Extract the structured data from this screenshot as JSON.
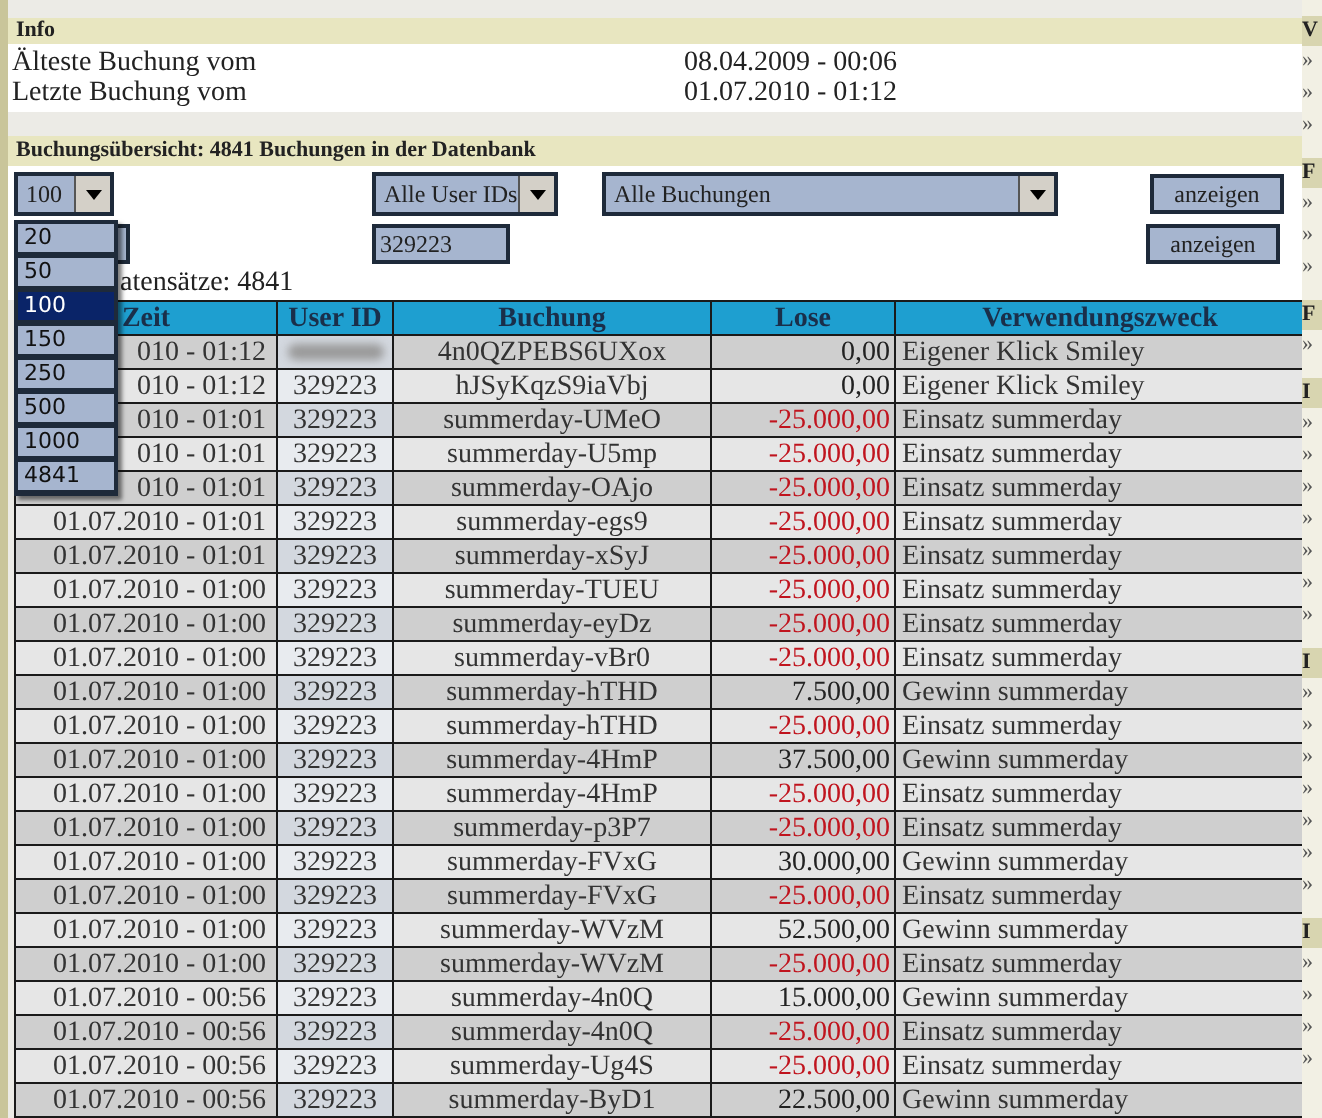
{
  "info": {
    "title": "Info",
    "rows": [
      {
        "label": "Älteste Buchung vom",
        "value": "08.04.2009 - 00:06"
      },
      {
        "label": "Letzte Buchung vom",
        "value": "01.07.2010 - 01:12"
      }
    ]
  },
  "overview": {
    "title": "Buchungsübersicht: 4841 Buchungen in der Datenbank",
    "page_size": {
      "value": "100",
      "options": [
        {
          "label": "20",
          "selected": false
        },
        {
          "label": "50",
          "selected": false
        },
        {
          "label": "100",
          "selected": true
        },
        {
          "label": "150",
          "selected": false
        },
        {
          "label": "250",
          "selected": false
        },
        {
          "label": "500",
          "selected": false
        },
        {
          "label": "1000",
          "selected": false
        },
        {
          "label": "4841",
          "selected": false
        }
      ]
    },
    "user_filter": "Alle User IDs",
    "type_filter": "Alle Buchungen",
    "show_button": "anzeigen",
    "user_id_field": "329223",
    "show_button_2": "anzeigen",
    "record_count": "atensätze: 4841"
  },
  "table": {
    "columns": [
      "Zeit",
      "User ID",
      "Buchung",
      "Lose",
      "Verwendungszweck"
    ],
    "rows": [
      {
        "zeit": "010 - 01:12",
        "user_id": "",
        "redacted": true,
        "buchung": "4n0QZPEBS6UXox",
        "lose": "0,00",
        "negative": false,
        "zweck": "Eigener Klick Smiley"
      },
      {
        "zeit": "010 - 01:12",
        "user_id": "329223",
        "redacted": false,
        "buchung": "hJSyKqzS9iaVbj",
        "lose": "0,00",
        "negative": false,
        "zweck": "Eigener Klick Smiley"
      },
      {
        "zeit": "010 - 01:01",
        "user_id": "329223",
        "redacted": false,
        "buchung": "summerday-UMeO",
        "lose": "-25.000,00",
        "negative": true,
        "zweck": "Einsatz summerday"
      },
      {
        "zeit": "010 - 01:01",
        "user_id": "329223",
        "redacted": false,
        "buchung": "summerday-U5mp",
        "lose": "-25.000,00",
        "negative": true,
        "zweck": "Einsatz summerday"
      },
      {
        "zeit": "010 - 01:01",
        "user_id": "329223",
        "redacted": false,
        "buchung": "summerday-OAjo",
        "lose": "-25.000,00",
        "negative": true,
        "zweck": "Einsatz summerday"
      },
      {
        "zeit": "01.07.2010 - 01:01",
        "user_id": "329223",
        "redacted": false,
        "buchung": "summerday-egs9",
        "lose": "-25.000,00",
        "negative": true,
        "zweck": "Einsatz summerday"
      },
      {
        "zeit": "01.07.2010 - 01:01",
        "user_id": "329223",
        "redacted": false,
        "buchung": "summerday-xSyJ",
        "lose": "-25.000,00",
        "negative": true,
        "zweck": "Einsatz summerday"
      },
      {
        "zeit": "01.07.2010 - 01:00",
        "user_id": "329223",
        "redacted": false,
        "buchung": "summerday-TUEU",
        "lose": "-25.000,00",
        "negative": true,
        "zweck": "Einsatz summerday"
      },
      {
        "zeit": "01.07.2010 - 01:00",
        "user_id": "329223",
        "redacted": false,
        "buchung": "summerday-eyDz",
        "lose": "-25.000,00",
        "negative": true,
        "zweck": "Einsatz summerday"
      },
      {
        "zeit": "01.07.2010 - 01:00",
        "user_id": "329223",
        "redacted": false,
        "buchung": "summerday-vBr0",
        "lose": "-25.000,00",
        "negative": true,
        "zweck": "Einsatz summerday"
      },
      {
        "zeit": "01.07.2010 - 01:00",
        "user_id": "329223",
        "redacted": false,
        "buchung": "summerday-hTHD",
        "lose": "7.500,00",
        "negative": false,
        "zweck": "Gewinn summerday"
      },
      {
        "zeit": "01.07.2010 - 01:00",
        "user_id": "329223",
        "redacted": false,
        "buchung": "summerday-hTHD",
        "lose": "-25.000,00",
        "negative": true,
        "zweck": "Einsatz summerday"
      },
      {
        "zeit": "01.07.2010 - 01:00",
        "user_id": "329223",
        "redacted": false,
        "buchung": "summerday-4HmP",
        "lose": "37.500,00",
        "negative": false,
        "zweck": "Gewinn summerday"
      },
      {
        "zeit": "01.07.2010 - 01:00",
        "user_id": "329223",
        "redacted": false,
        "buchung": "summerday-4HmP",
        "lose": "-25.000,00",
        "negative": true,
        "zweck": "Einsatz summerday"
      },
      {
        "zeit": "01.07.2010 - 01:00",
        "user_id": "329223",
        "redacted": false,
        "buchung": "summerday-p3P7",
        "lose": "-25.000,00",
        "negative": true,
        "zweck": "Einsatz summerday"
      },
      {
        "zeit": "01.07.2010 - 01:00",
        "user_id": "329223",
        "redacted": false,
        "buchung": "summerday-FVxG",
        "lose": "30.000,00",
        "negative": false,
        "zweck": "Gewinn summerday"
      },
      {
        "zeit": "01.07.2010 - 01:00",
        "user_id": "329223",
        "redacted": false,
        "buchung": "summerday-FVxG",
        "lose": "-25.000,00",
        "negative": true,
        "zweck": "Einsatz summerday"
      },
      {
        "zeit": "01.07.2010 - 01:00",
        "user_id": "329223",
        "redacted": false,
        "buchung": "summerday-WVzM",
        "lose": "52.500,00",
        "negative": false,
        "zweck": "Gewinn summerday"
      },
      {
        "zeit": "01.07.2010 - 01:00",
        "user_id": "329223",
        "redacted": false,
        "buchung": "summerday-WVzM",
        "lose": "-25.000,00",
        "negative": true,
        "zweck": "Einsatz summerday"
      },
      {
        "zeit": "01.07.2010 - 00:56",
        "user_id": "329223",
        "redacted": false,
        "buchung": "summerday-4n0Q",
        "lose": "15.000,00",
        "negative": false,
        "zweck": "Gewinn summerday"
      },
      {
        "zeit": "01.07.2010 - 00:56",
        "user_id": "329223",
        "redacted": false,
        "buchung": "summerday-4n0Q",
        "lose": "-25.000,00",
        "negative": true,
        "zweck": "Einsatz summerday"
      },
      {
        "zeit": "01.07.2010 - 00:56",
        "user_id": "329223",
        "redacted": false,
        "buchung": "summerday-Ug4S",
        "lose": "-25.000,00",
        "negative": true,
        "zweck": "Einsatz summerday"
      },
      {
        "zeit": "01.07.2010 - 00:56",
        "user_id": "329223",
        "redacted": false,
        "buchung": "summerday-ByD1",
        "lose": "22.500,00",
        "negative": false,
        "zweck": "Gewinn summerday"
      }
    ]
  },
  "sidebar": {
    "sections": [
      {
        "heading": "V",
        "items": [
          "»",
          "»",
          "»"
        ]
      },
      {
        "heading": "F",
        "items": [
          "»",
          "»",
          "»"
        ]
      },
      {
        "heading": "F",
        "items": [
          "»"
        ]
      },
      {
        "heading": "I",
        "items": [
          "»",
          "»",
          "»",
          "»",
          "»",
          "»",
          "»"
        ]
      },
      {
        "heading": "I",
        "items": [
          "»",
          "»",
          "»",
          "»",
          "»",
          "»",
          "»"
        ]
      },
      {
        "heading": "I",
        "items": [
          "»",
          "»",
          "»",
          "»"
        ]
      }
    ]
  }
}
